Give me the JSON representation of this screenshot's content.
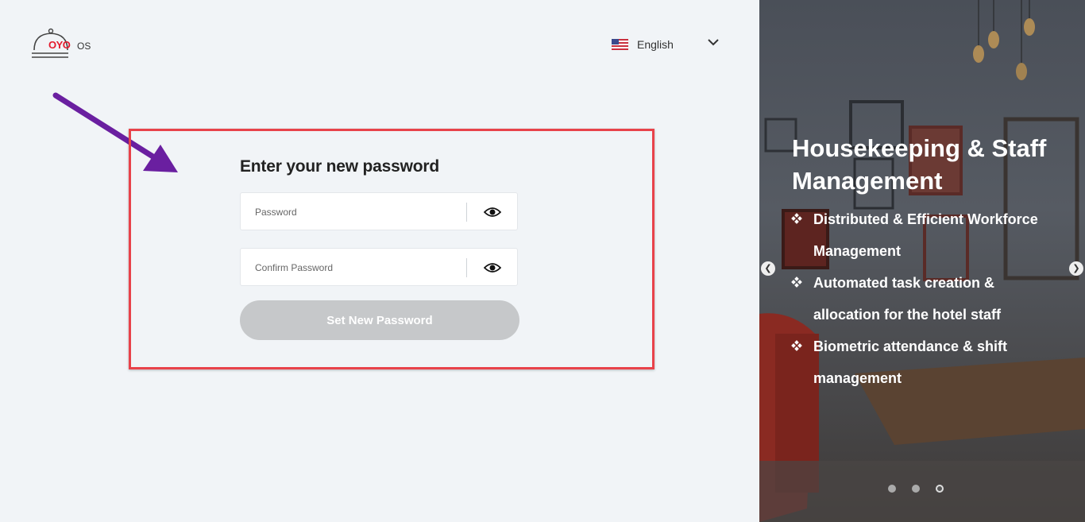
{
  "logo": {
    "brand": "OYO",
    "suffix": "OS"
  },
  "language": {
    "selected": "English",
    "flag_icon": "us-flag-icon"
  },
  "form": {
    "title": "Enter your new password",
    "password_placeholder": "Password",
    "password_value": "",
    "confirm_placeholder": "Confirm Password",
    "confirm_value": "",
    "submit_label": "Set New Password"
  },
  "carousel": {
    "title": "Housekeeping & Staff Management",
    "bullets": [
      "Distributed & Efficient Workforce Management",
      "Automated task creation & allocation for the hotel staff",
      "Biometric attendance & shift management"
    ],
    "slide_count": 3,
    "active_slide": 3
  },
  "colors": {
    "brand_red": "#e41b2d",
    "highlight_border": "#e8424a",
    "annotation_arrow": "#6a1fa0",
    "button_disabled": "#c6c8ca",
    "page_bg": "#f1f4f7"
  }
}
